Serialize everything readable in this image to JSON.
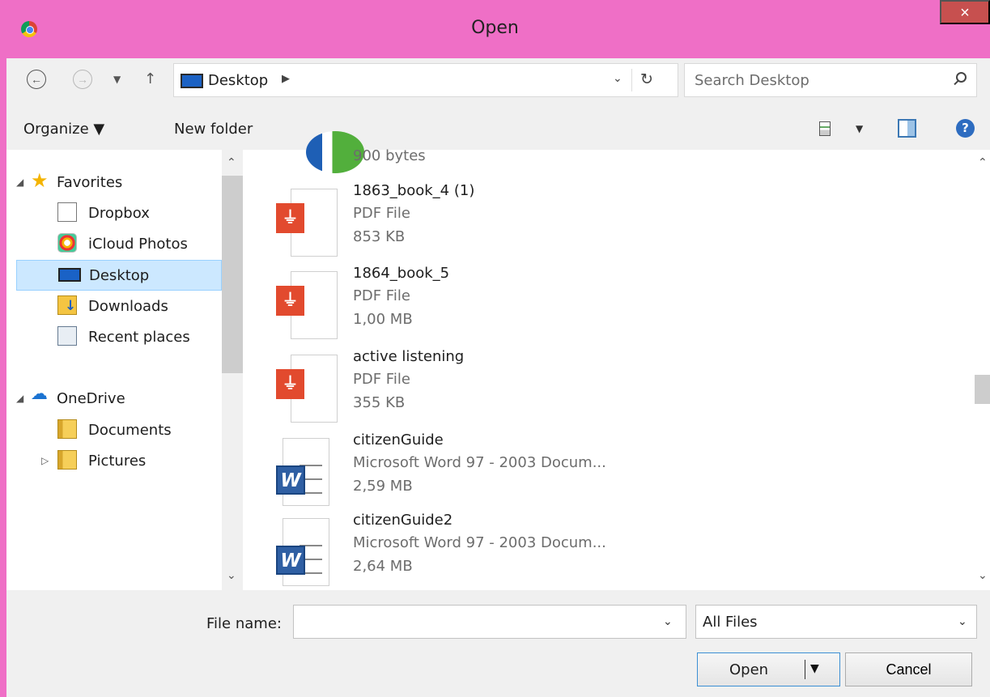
{
  "window": {
    "title": "Open",
    "close_glyph": "×",
    "app_icon": "chrome-icon"
  },
  "address_bar": {
    "back_glyph": "←",
    "forward_glyph": "→",
    "recent_glyph": "▼",
    "up_glyph": "↑",
    "location": "Desktop",
    "breadcrumb_arrow": "▶",
    "dropdown_glyph": "⌄",
    "refresh_glyph": "↻",
    "search_placeholder": "Search Desktop"
  },
  "toolbar": {
    "organize": "Organize ▼",
    "new_folder": "New folder",
    "view_arrow": "▼",
    "help_glyph": "?"
  },
  "nav_pane": {
    "scroll_up": "⌃",
    "scroll_down": "⌄",
    "favorites": {
      "toggle": "◢",
      "label": "Favorites"
    },
    "favorites_items": [
      {
        "label": "Dropbox",
        "icon": "document-icon"
      },
      {
        "label": "iCloud Photos",
        "icon": "photos-icon"
      },
      {
        "label": "Desktop",
        "icon": "desktop-icon",
        "selected": true
      },
      {
        "label": "Downloads",
        "icon": "downloads-icon"
      },
      {
        "label": "Recent places",
        "icon": "recent-places-icon"
      }
    ],
    "onedrive": {
      "toggle": "◢",
      "label": "OneDrive"
    },
    "onedrive_items": [
      {
        "label": "Documents",
        "icon": "folder-icon"
      },
      {
        "label": "Pictures",
        "icon": "folder-icon",
        "toggle": "▷"
      }
    ]
  },
  "files": [
    {
      "name": "",
      "type": "",
      "size": "900 bytes",
      "icon": "partial-file-icon"
    },
    {
      "name": "1863_book_4 (1)",
      "type": "PDF File",
      "size": "853 KB",
      "icon": "pdf-file-icon"
    },
    {
      "name": "1864_book_5",
      "type": "PDF File",
      "size": "1,00 MB",
      "icon": "pdf-file-icon"
    },
    {
      "name": "active listening",
      "type": "PDF File",
      "size": "355 KB",
      "icon": "pdf-file-icon"
    },
    {
      "name": "citizenGuide",
      "type": "Microsoft Word 97 - 2003 Docum...",
      "size": "2,59 MB",
      "icon": "word-file-icon"
    },
    {
      "name": "citizenGuide2",
      "type": "Microsoft Word 97 - 2003 Docum...",
      "size": "2,64 MB",
      "icon": "word-file-icon"
    }
  ],
  "bottom": {
    "file_name_label": "File name:",
    "file_name_value": "",
    "filter_value": "All Files",
    "dropdown_glyph": "⌄",
    "open_label": "Open",
    "open_arrow": "▼",
    "cancel_label": "Cancel"
  },
  "colors": {
    "title_bar": "#ef6fc6",
    "close_button": "#c7504f",
    "selected_item": "#cce8ff",
    "pdf_badge": "#e24a2e",
    "word_badge": "#2f5fa3"
  }
}
